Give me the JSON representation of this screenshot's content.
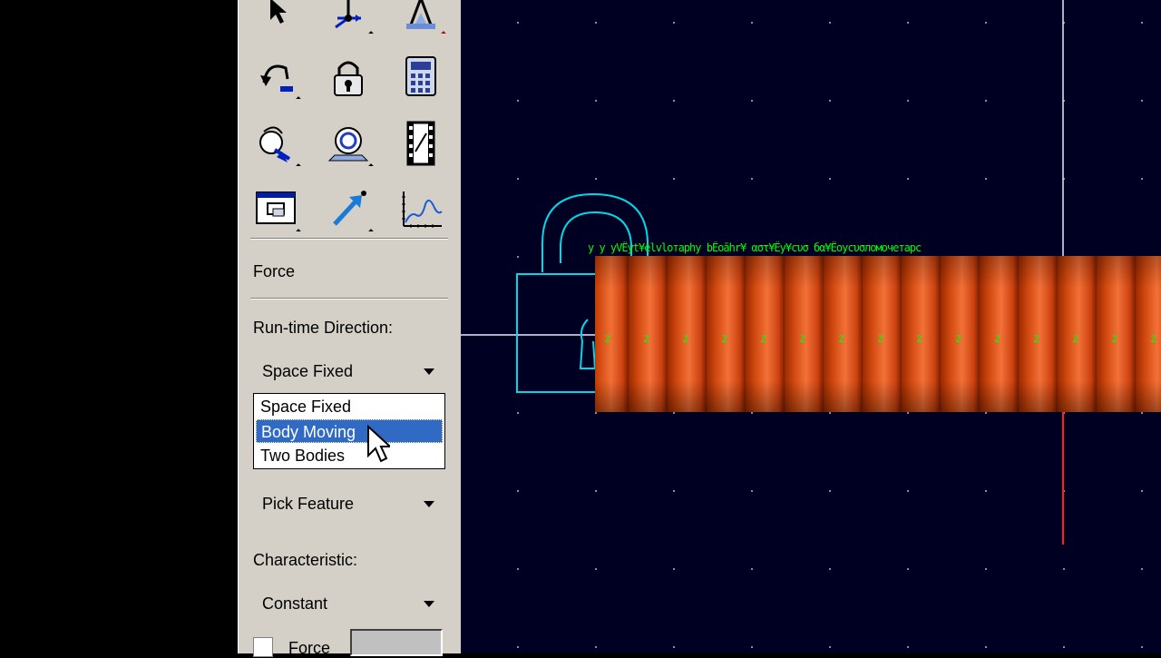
{
  "panel": {
    "section_title": "Force",
    "runtime_direction_label": "Run-time Direction:",
    "runtime_direction_value": "Space Fixed",
    "dropdown_options": [
      "Space Fixed",
      "Body Moving",
      "Two Bodies"
    ],
    "selected_option": "Body Moving",
    "pick_feature_value": "Pick Feature",
    "characteristic_label": "Characteristic:",
    "characteristic_value": "Constant",
    "force_checkbox_label": "Force"
  },
  "toolbar": {
    "icons": [
      "select-arrow-icon",
      "coordinate-axes-icon",
      "joint-icon",
      "rotate-undo-icon",
      "lock-icon",
      "calculator-icon",
      "rotate-view-icon",
      "camera-icon",
      "film-icon",
      "dialog-icon",
      "vector-arrow-icon",
      "plot-graph-icon"
    ]
  },
  "canvas": {
    "z_label": "z",
    "overlay_text": "y y  yVЁyt¥elvloтaphy bЁoāhr¥  αστ¥Ёy¥сυσ  бα¥Ёoyсυσломочетарс"
  },
  "colors": {
    "panel_bg": "#d4d0c8",
    "canvas_bg": "#000022",
    "selection": "#316ac5",
    "wireframe": "#00d8e8",
    "coil": "#e05a20",
    "label_green": "#00ff00"
  }
}
